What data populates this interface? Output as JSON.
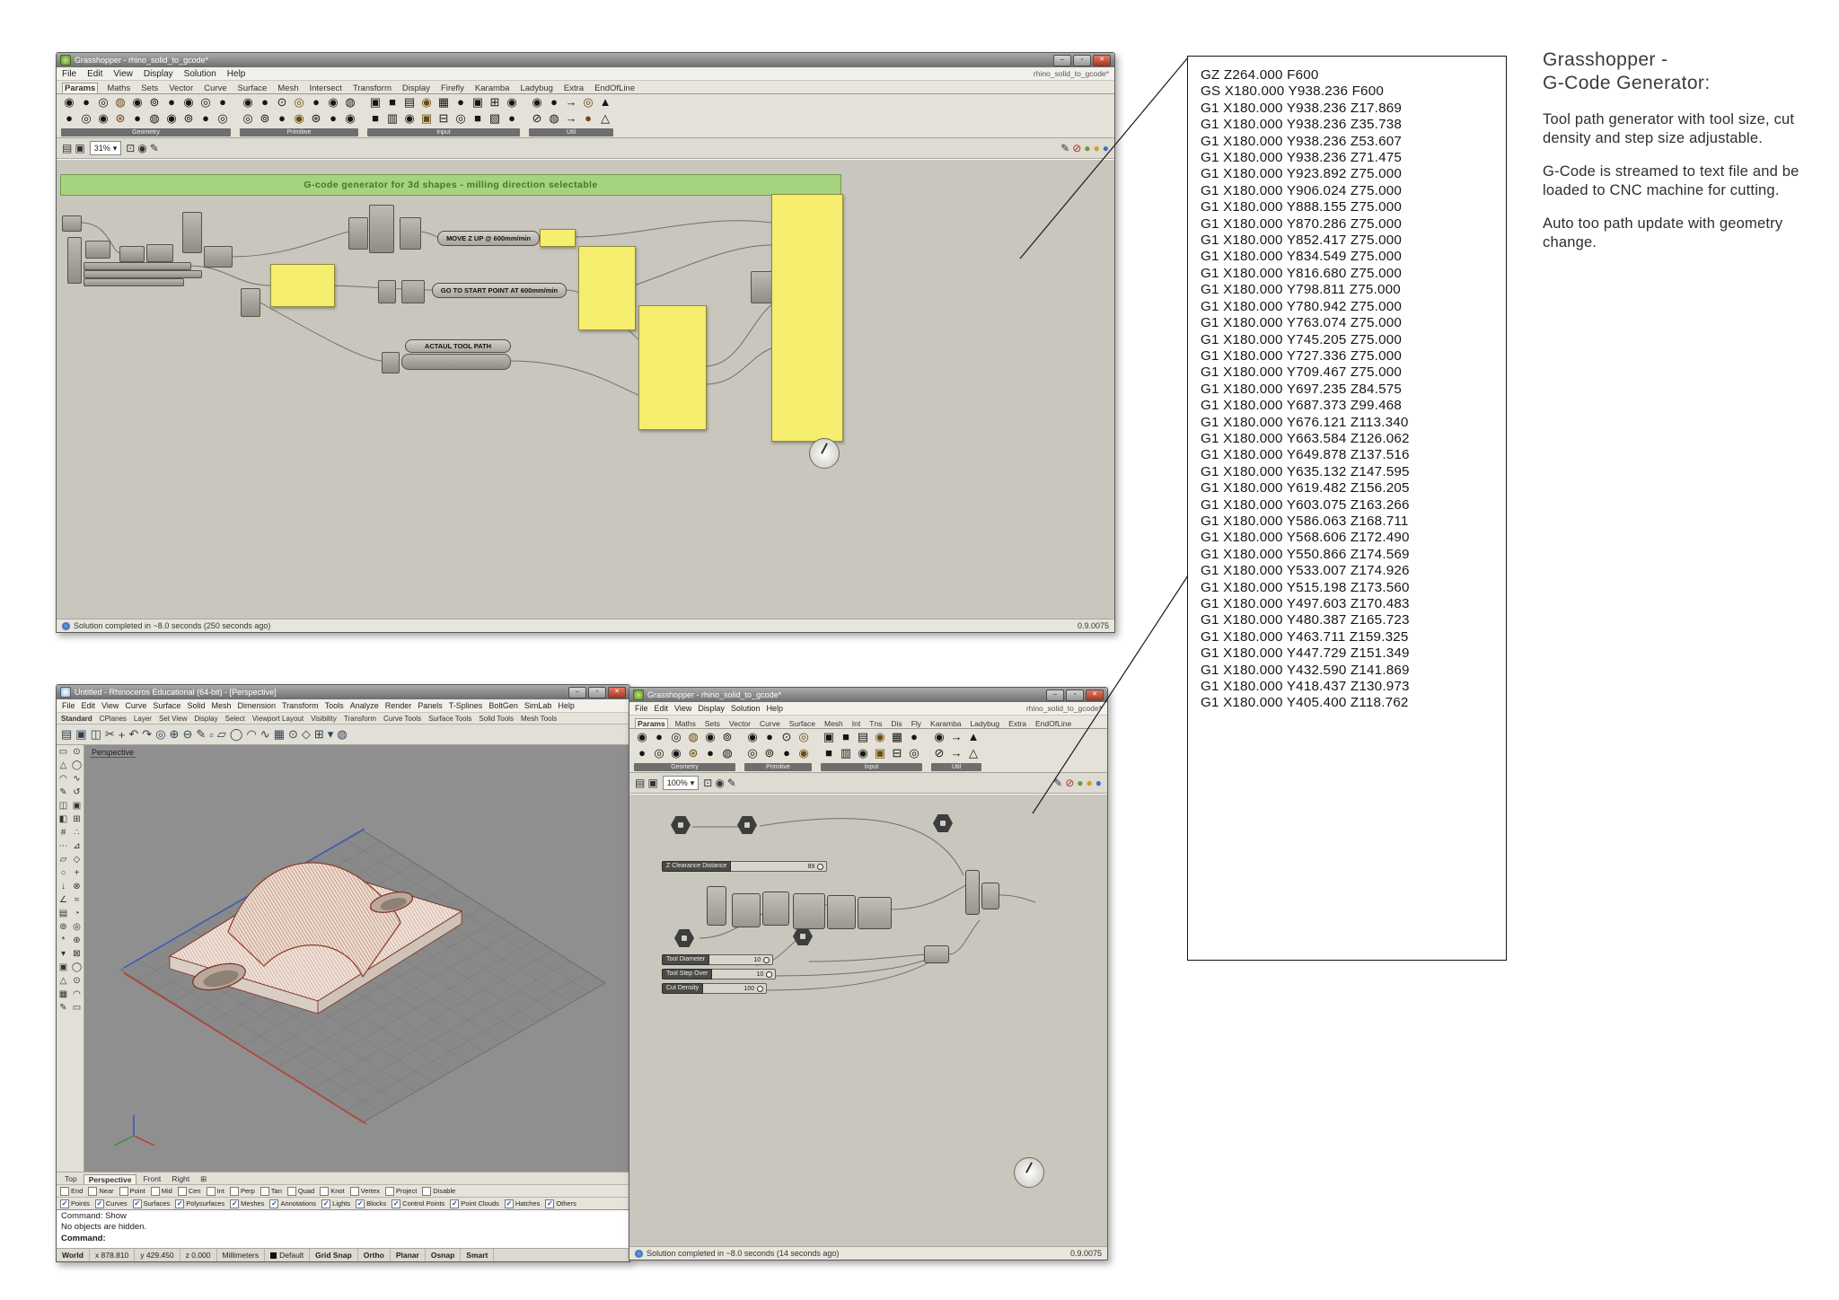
{
  "colors": {
    "panel_yellow": "#f5ee6e",
    "banner_green": "#a6d37e",
    "close_red": "#ab3422",
    "check_blue": "#1546c2"
  },
  "chrome": {
    "min": "–",
    "max": "▫",
    "close": "✕",
    "caret": "▾"
  },
  "gh_top": {
    "title": "Grasshopper - rhino_solid_to_gcode*",
    "doc_name": "rhino_solid_to_gcode*",
    "menus": [
      "File",
      "Edit",
      "View",
      "Display",
      "Solution",
      "Help"
    ],
    "tabs": [
      {
        "label": "Params",
        "cls": "active"
      },
      {
        "label": "Maths"
      },
      {
        "label": "Sets"
      },
      {
        "label": "Vector"
      },
      {
        "label": "Curve"
      },
      {
        "label": "Surface"
      },
      {
        "label": "Mesh"
      },
      {
        "label": "Intersect"
      },
      {
        "label": "Transform"
      },
      {
        "label": "Display"
      },
      {
        "label": "Firefly"
      },
      {
        "label": "Karamba"
      },
      {
        "label": "Ladybug"
      },
      {
        "label": "Extra"
      },
      {
        "label": "EndOfLine"
      }
    ],
    "tb": {
      "labels": [
        "Geometry",
        "Primitive",
        "Input",
        "Util"
      ],
      "g1r1": [
        "◉",
        "●",
        "◎",
        "◍",
        "◉",
        "⊚",
        "●",
        "◉",
        "◎",
        "●"
      ],
      "g1r2": [
        "●",
        "◎",
        "◉",
        "⊛",
        "●",
        "◍",
        "◉",
        "⊚",
        "●",
        "◎"
      ],
      "g2r1": [
        "◉",
        "●",
        "⊙",
        "◎",
        "●",
        "◉",
        "◍"
      ],
      "g2r2": [
        "◎",
        "⊚",
        "●",
        "◉",
        "⊛",
        "●",
        "◉"
      ],
      "g3r1": [
        "▣",
        "■",
        "▤",
        "◉",
        "▦",
        "●",
        "▣",
        "⊞",
        "◉"
      ],
      "g3r2": [
        "■",
        "▥",
        "◉",
        "▣",
        "⊟",
        "◎",
        "■",
        "▧",
        "●"
      ],
      "g4r1": [
        "◉",
        "●",
        "→",
        "◎",
        "▲"
      ],
      "g4r2": [
        "⊘",
        "◍",
        "→",
        "●",
        "△"
      ]
    },
    "zoom": "31%",
    "cb_left": [
      "▤",
      "▣"
    ],
    "cb_mid": [
      "⊡",
      "◉",
      "✎"
    ],
    "cb_right": [
      "✎",
      "⊘",
      "●",
      "●",
      "●"
    ],
    "canvas": {
      "banner": "G-code generator for 3d shapes - milling direction selectable",
      "move_z": "MOVE Z UP @ 600mm/min",
      "go_start": "GO TO START POINT AT 600mm/min",
      "tool_path": "ACTAUL TOOL PATH"
    },
    "status": "Solution completed in ~8.0 seconds (250 seconds ago)",
    "version": "0.9.0075"
  },
  "rhino": {
    "title": "Untitled - Rhinoceros Educational (64-bit) - [Perspective]",
    "menus": [
      "File",
      "Edit",
      "View",
      "Curve",
      "Surface",
      "Solid",
      "Mesh",
      "Dimension",
      "Transform",
      "Tools",
      "Analyze",
      "Render",
      "Panels",
      "T-Splines",
      "BoltGen",
      "SimLab",
      "Help"
    ],
    "ttabs": [
      "Standard",
      "CPlanes",
      "Layer",
      "Set View",
      "Display",
      "Select",
      "Viewport Layout",
      "Visibility",
      "Transform",
      "Curve Tools",
      "Surface Tools",
      "Solid Tools",
      "Mesh Tools"
    ],
    "toolbar_icons": [
      "▤",
      "▣",
      "◫",
      "✂",
      "+",
      "↶",
      "↷",
      "◎",
      "⊕",
      "⊖",
      "✎",
      "▫",
      "▱",
      "◯",
      "◠",
      "∿",
      "▦",
      "⊙",
      "◇",
      "⊞",
      "▾",
      "◍"
    ],
    "sidebar_icons": [
      "▭",
      "⊙",
      "△",
      "◯",
      "◠",
      "∿",
      "✎",
      "↺",
      "◫",
      "▣",
      "◧",
      "⊞",
      "#",
      "∴",
      "⋯",
      "⊿",
      "▱",
      "◇",
      "○",
      "+",
      "↓",
      "⊗",
      "∠",
      "≈",
      "▤",
      "◔",
      "⊚",
      "◎",
      "*",
      "⊕",
      "▾",
      "⊠",
      "▣",
      "◯",
      "△",
      "⊙",
      "▦",
      "◠",
      "✎",
      "▭"
    ],
    "viewport_label": "Perspective",
    "view_tabs": [
      {
        "label": "Top"
      },
      {
        "label": "Perspective",
        "cls": "active"
      },
      {
        "label": "Front"
      },
      {
        "label": "Right"
      }
    ],
    "view_tabs_icon": "⊞",
    "osnaps": [
      {
        "label": "End",
        "mark": ""
      },
      {
        "label": "Near",
        "mark": ""
      },
      {
        "label": "Point",
        "mark": ""
      },
      {
        "label": "Mid",
        "mark": ""
      },
      {
        "label": "Cen",
        "mark": ""
      },
      {
        "label": "Int",
        "mark": ""
      },
      {
        "label": "Perp",
        "mark": ""
      },
      {
        "label": "Tan",
        "mark": ""
      },
      {
        "label": "Quad",
        "mark": ""
      },
      {
        "label": "Knot",
        "mark": ""
      },
      {
        "label": "Vertex",
        "mark": ""
      },
      {
        "label": "Project",
        "mark": ""
      },
      {
        "label": "Disable",
        "mark": ""
      }
    ],
    "filters": [
      {
        "label": "Points",
        "mark": "✓"
      },
      {
        "label": "Curves",
        "mark": "✓"
      },
      {
        "label": "Surfaces",
        "mark": "✓"
      },
      {
        "label": "Polysurfaces",
        "mark": "✓"
      },
      {
        "label": "Meshes",
        "mark": "✓"
      },
      {
        "label": "Annotations",
        "mark": "✓"
      },
      {
        "label": "Lights",
        "mark": "✓"
      },
      {
        "label": "Blocks",
        "mark": "✓"
      },
      {
        "label": "Control Points",
        "mark": "✓"
      },
      {
        "label": "Point Clouds",
        "mark": "✓"
      },
      {
        "label": "Hatches",
        "mark": "✓"
      },
      {
        "label": "Others",
        "mark": "✓"
      }
    ],
    "command": {
      "history": [
        "Command: Show",
        "No objects are hidden."
      ],
      "prompt": "Command:"
    },
    "status": {
      "cplane": "World",
      "x": "x 878.810",
      "y": "y 429.450",
      "z": "z 0.000",
      "units": "Millimeters",
      "layer": "Default",
      "toggles": [
        "Grid Snap",
        "Ortho",
        "Planar",
        "Osnap",
        "Smart"
      ]
    }
  },
  "gh_bottom": {
    "title": "Grasshopper - rhino_solid_to_gcode*",
    "doc_name": "rhino_solid_to_gcode*",
    "menus": [
      "File",
      "Edit",
      "View",
      "Display",
      "Solution",
      "Help"
    ],
    "tabs": [
      {
        "label": "Params",
        "cls": "active"
      },
      {
        "label": "Maths"
      },
      {
        "label": "Sets"
      },
      {
        "label": "Vector"
      },
      {
        "label": "Curve"
      },
      {
        "label": "Surface"
      },
      {
        "label": "Mesh"
      },
      {
        "label": "Int"
      },
      {
        "label": "Tns"
      },
      {
        "label": "Dis"
      },
      {
        "label": "Fly"
      },
      {
        "label": "Karamba"
      },
      {
        "label": "Ladybug"
      },
      {
        "label": "Extra"
      },
      {
        "label": "EndOfLine"
      }
    ],
    "tb": {
      "labels": [
        "Geometry",
        "Primitive",
        "Input",
        "Util"
      ],
      "g1r1": [
        "◉",
        "●",
        "◎",
        "◍",
        "◉",
        "⊚"
      ],
      "g1r2": [
        "●",
        "◎",
        "◉",
        "⊛",
        "●",
        "◍"
      ],
      "g2r1": [
        "◉",
        "●",
        "⊙",
        "◎"
      ],
      "g2r2": [
        "◎",
        "⊚",
        "●",
        "◉"
      ],
      "g3r1": [
        "▣",
        "■",
        "▤",
        "◉",
        "▦",
        "●"
      ],
      "g3r2": [
        "■",
        "▥",
        "◉",
        "▣",
        "⊟",
        "◎"
      ],
      "g4r1": [
        "◉",
        "→",
        "▲"
      ],
      "g4r2": [
        "⊘",
        "→",
        "△"
      ]
    },
    "zoom": "100%",
    "cb_left": [
      "▤",
      "▣"
    ],
    "cb_mid": [
      "⊡",
      "◉",
      "✎"
    ],
    "cb_right": [
      "✎",
      "⊘",
      "●",
      "●",
      "●"
    ],
    "sliders": [
      {
        "label": "Z Clearance Distance",
        "value": "89"
      },
      {
        "label": "Tool Diameter",
        "value": "10"
      },
      {
        "label": "Tool Step Over",
        "value": "10"
      },
      {
        "label": "Cut Density",
        "value": "100"
      }
    ],
    "status": "Solution completed in ~8.0 seconds (14 seconds ago)",
    "version": "0.9.0075"
  },
  "gcode": {
    "lines": [
      "GZ Z264.000 F600",
      "GS X180.000 Y938.236 F600",
      "G1 X180.000 Y938.236 Z17.869",
      "G1 X180.000 Y938.236 Z35.738",
      "G1 X180.000 Y938.236 Z53.607",
      "G1 X180.000 Y938.236 Z71.475",
      "G1 X180.000 Y923.892 Z75.000",
      "G1 X180.000 Y906.024 Z75.000",
      "G1 X180.000 Y888.155 Z75.000",
      "G1 X180.000 Y870.286 Z75.000",
      "G1 X180.000 Y852.417 Z75.000",
      "G1 X180.000 Y834.549 Z75.000",
      "G1 X180.000 Y816.680 Z75.000",
      "G1 X180.000 Y798.811 Z75.000",
      "G1 X180.000 Y780.942 Z75.000",
      "G1 X180.000 Y763.074 Z75.000",
      "G1 X180.000 Y745.205 Z75.000",
      "G1 X180.000 Y727.336 Z75.000",
      "G1 X180.000 Y709.467 Z75.000",
      "G1 X180.000 Y697.235 Z84.575",
      "G1 X180.000 Y687.373 Z99.468",
      "G1 X180.000 Y676.121 Z113.340",
      "G1 X180.000 Y663.584 Z126.062",
      "G1 X180.000 Y649.878 Z137.516",
      "G1 X180.000 Y635.132 Z147.595",
      "G1 X180.000 Y619.482 Z156.205",
      "G1 X180.000 Y603.075 Z163.266",
      "G1 X180.000 Y586.063 Z168.711",
      "G1 X180.000 Y568.606 Z172.490",
      "G1 X180.000 Y550.866 Z174.569",
      "G1 X180.000 Y533.007 Z174.926",
      "G1 X180.000 Y515.198 Z173.560",
      "G1 X180.000 Y497.603 Z170.483",
      "G1 X180.000 Y480.387 Z165.723",
      "G1 X180.000 Y463.711 Z159.325",
      "G1 X180.000 Y447.729 Z151.349",
      "G1 X180.000 Y432.590 Z141.869",
      "G1 X180.000 Y418.437 Z130.973",
      "G1 X180.000 Y405.400 Z118.762"
    ]
  },
  "note": {
    "title": "Grasshopper -\nG-Code Generator:",
    "paragraphs": [
      "Tool path generator with tool size, cut density and step size adjustable.",
      "G-Code is streamed to text file and be loaded to CNC machine for cutting.",
      "Auto too path update with geometry change."
    ]
  }
}
